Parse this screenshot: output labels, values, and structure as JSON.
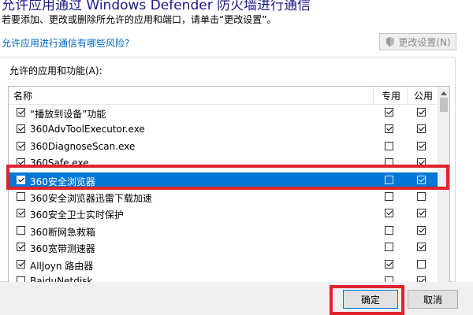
{
  "header": {
    "title": "允许应用通过 Windows Defender 防火墙进行通信",
    "subtitle": "若要添加、更改或删除所允许的应用和端口，请单击“更改设置”。",
    "risk_link": "允许应用进行通信有哪些风险?",
    "change_settings_label": "更改设置(N)"
  },
  "group": {
    "label": "允许的应用和功能(A):",
    "columns": {
      "name": "名称",
      "private": "专用",
      "public": "公用"
    },
    "rows": [
      {
        "name": "“播放到设备”功能",
        "enabled": true,
        "private": true,
        "public": true
      },
      {
        "name": "360AdvToolExecutor.exe",
        "enabled": true,
        "private": true,
        "public": true
      },
      {
        "name": "360DiagnoseScan.exe",
        "enabled": true,
        "private": false,
        "public": true
      },
      {
        "name": "360Safe.exe",
        "enabled": true,
        "private": false,
        "public": true
      },
      {
        "name": "360安全浏览器",
        "enabled": true,
        "private": false,
        "public": true,
        "selected": true
      },
      {
        "name": "360安全浏览器迅雷下载加速",
        "enabled": false,
        "private": false,
        "public": false
      },
      {
        "name": "360安全卫士实时保护",
        "enabled": true,
        "private": true,
        "public": true
      },
      {
        "name": "360断网急救箱",
        "enabled": false,
        "private": false,
        "public": true
      },
      {
        "name": "360宽带测速器",
        "enabled": true,
        "private": false,
        "public": true
      },
      {
        "name": "AllJoyn 路由器",
        "enabled": true,
        "private": true,
        "public": false
      },
      {
        "name": "BaiduNetdisk",
        "enabled": false,
        "private": false,
        "public": true
      }
    ]
  },
  "footer": {
    "ok_label": "确定",
    "cancel_label": "取消"
  }
}
